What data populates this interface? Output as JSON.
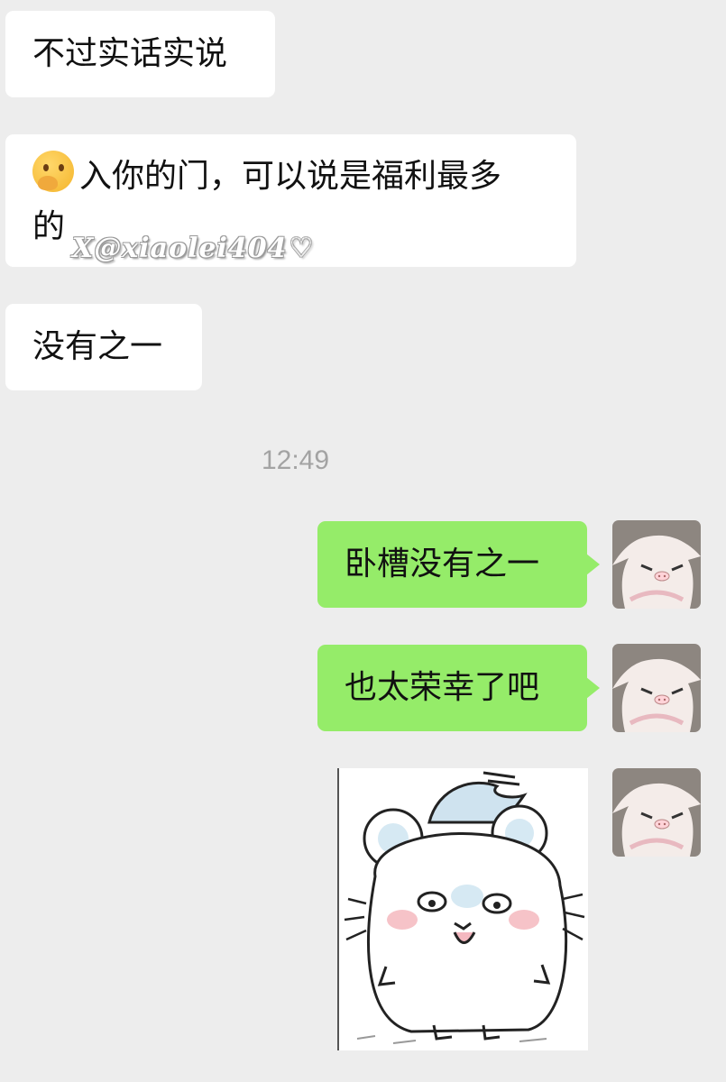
{
  "messages": {
    "m1": "不过实话实说",
    "m2_emoji": "thinking-face-emoji",
    "m2_line1": "入你的门，可以说是福利最多",
    "m2_line2": "的",
    "m3": "没有之一",
    "timestamp": "12:49",
    "m4": "卧槽没有之一",
    "m5": "也太荣幸了吧"
  },
  "watermark": {
    "text": "X@xiaolei404",
    "heart": "♡"
  },
  "colors": {
    "background": "#ededed",
    "incoming_bubble": "#ffffff",
    "outgoing_bubble": "#95ec69",
    "timestamp": "#a3a3a3"
  },
  "icons": {
    "avatar": "anime-girl-avatar",
    "sticker": "hamster-cartoon-sticker"
  }
}
